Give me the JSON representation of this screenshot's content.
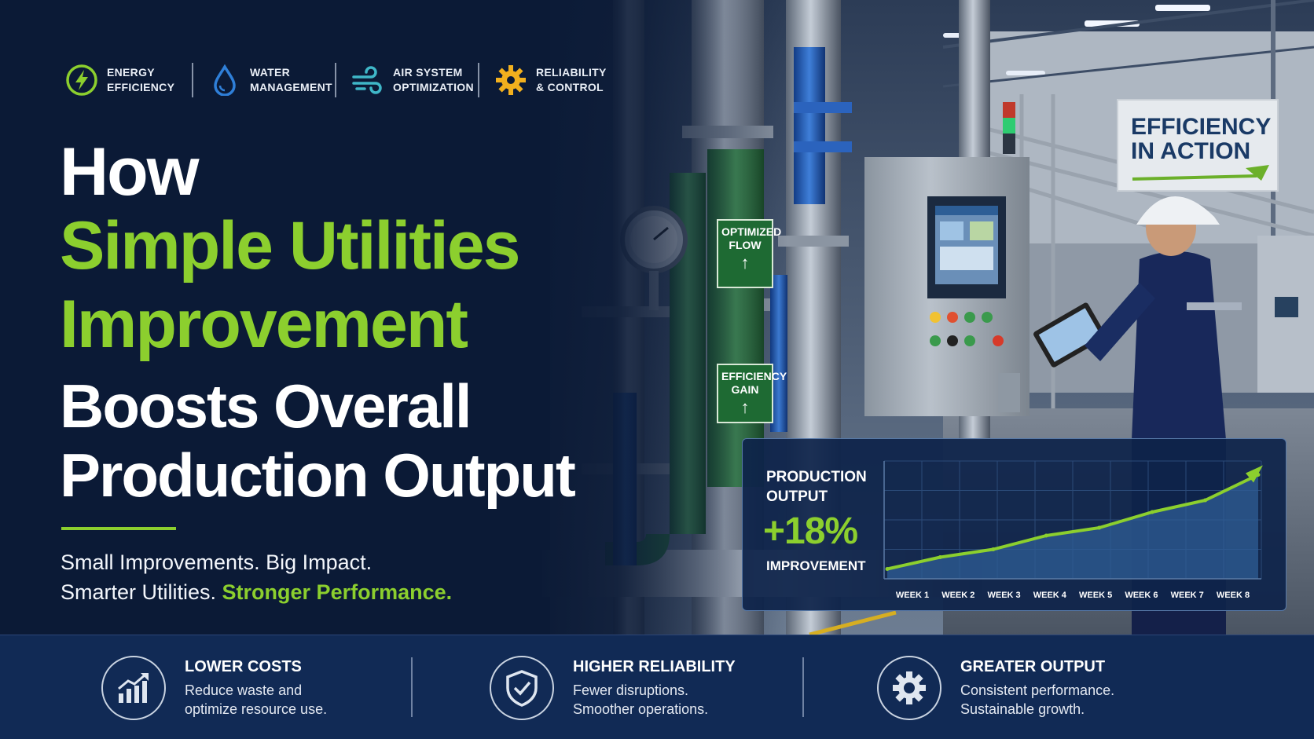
{
  "categories": [
    {
      "icon": "lightning-bolt-icon",
      "line1": "ENERGY",
      "line2": "EFFICIENCY",
      "color": "#8ccf2e"
    },
    {
      "icon": "water-drop-icon",
      "line1": "WATER",
      "line2": "MANAGEMENT",
      "color": "#2f7fd8"
    },
    {
      "icon": "air-flow-icon",
      "line1": "AIR SYSTEM",
      "line2": "OPTIMIZATION",
      "color": "#3fb7c8"
    },
    {
      "icon": "gear-icon",
      "line1": "RELIABILITY",
      "line2": "& CONTROL",
      "color": "#f2b01e"
    }
  ],
  "headline": {
    "line1": "How",
    "line2": "Simple Utilities",
    "line3": "Improvement",
    "line4": "Boosts Overall",
    "line5": "Production Output"
  },
  "subheadline": {
    "line1": "Small Improvements. Big Impact.",
    "line2_prefix": "Smarter Utilities. ",
    "line2_highlight": "Stronger Performance."
  },
  "scene_labels": {
    "pipe_tag_1": {
      "line1": "OPTIMIZED",
      "line2": "FLOW",
      "arrow": "↑"
    },
    "pipe_tag_2": {
      "line1": "EFFICIENCY",
      "line2": "GAIN",
      "arrow": "↑"
    },
    "wall_sign": {
      "line1": "EFFICIENCY",
      "line2": "IN ACTION"
    }
  },
  "chart_panel": {
    "label_line1": "PRODUCTION",
    "label_line2": "OUTPUT",
    "value": "+18%",
    "value_caption": "IMPROVEMENT"
  },
  "chart_data": {
    "type": "area",
    "title": "",
    "categories": [
      "WEEK 1",
      "WEEK 2",
      "WEEK 3",
      "WEEK 4",
      "WEEK 5",
      "WEEK 6",
      "WEEK 7",
      "WEEK 8"
    ],
    "series": [
      {
        "values": [
          1.0,
          2.2,
          3.0,
          4.4,
          5.2,
          6.8,
          8.0,
          10.6
        ]
      }
    ],
    "ylim": [
      0,
      12
    ],
    "grid": true,
    "line_color": "#8ccf2e",
    "fill_color": "#2f5d96"
  },
  "benefits": [
    {
      "icon": "rising-bar-chart-icon",
      "title": "LOWER COSTS",
      "desc1": "Reduce waste and",
      "desc2": "optimize resource use."
    },
    {
      "icon": "shield-check-icon",
      "title": "HIGHER RELIABILITY",
      "desc1": "Fewer disruptions.",
      "desc2": "Smoother operations."
    },
    {
      "icon": "gear-icon",
      "title": "GREATER OUTPUT",
      "desc1": "Consistent performance.",
      "desc2": "Sustainable growth."
    }
  ],
  "colors": {
    "navy": "#0b1a36",
    "accent_green": "#8ccf2e",
    "bottom_bar": "#112a55"
  }
}
